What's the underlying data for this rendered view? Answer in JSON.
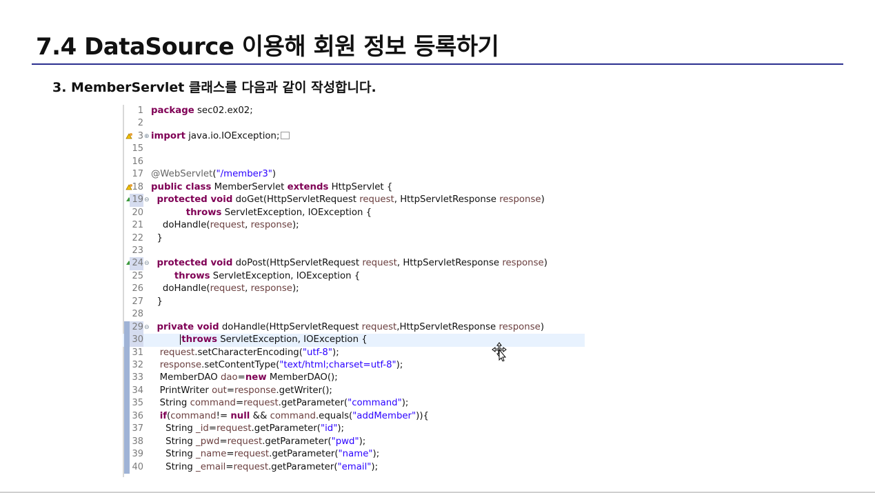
{
  "slide": {
    "title": "7.4 DataSource 이용해 회원 정보 등록하기",
    "subtitle": "3. MemberServlet 클래스를 다음과 같이 작성합니다."
  },
  "code_lines": [
    {
      "num": "1",
      "marker": "",
      "fold": "",
      "hl": false,
      "current": false,
      "tokens": [
        {
          "t": "package",
          "c": "kw"
        },
        {
          "t": " sec02.ex02;",
          "c": ""
        }
      ]
    },
    {
      "num": "2",
      "marker": "",
      "fold": "",
      "hl": false,
      "current": false,
      "tokens": []
    },
    {
      "num": "3",
      "marker": "warning",
      "fold": "plus",
      "hl": false,
      "current": false,
      "tokens": [
        {
          "t": "import",
          "c": "kw"
        },
        {
          "t": " java.io.IOException;",
          "c": ""
        },
        {
          "t": "",
          "c": "box"
        }
      ]
    },
    {
      "num": "15",
      "marker": "",
      "fold": "",
      "hl": false,
      "current": false,
      "tokens": []
    },
    {
      "num": "16",
      "marker": "",
      "fold": "",
      "hl": false,
      "current": false,
      "tokens": []
    },
    {
      "num": "17",
      "marker": "",
      "fold": "",
      "hl": false,
      "current": false,
      "tokens": [
        {
          "t": "@WebServlet",
          "c": "ann"
        },
        {
          "t": "(",
          "c": ""
        },
        {
          "t": "\"/member3\"",
          "c": "str"
        },
        {
          "t": ")",
          "c": ""
        }
      ]
    },
    {
      "num": "18",
      "marker": "warning",
      "fold": "",
      "hl": false,
      "current": false,
      "tokens": [
        {
          "t": "public class",
          "c": "kw"
        },
        {
          "t": " MemberServlet ",
          "c": ""
        },
        {
          "t": "extends",
          "c": "kw"
        },
        {
          "t": " HttpServlet {",
          "c": ""
        }
      ]
    },
    {
      "num": "19",
      "marker": "override",
      "fold": "minus",
      "hl": true,
      "current": false,
      "tokens": [
        {
          "t": "  ",
          "c": ""
        },
        {
          "t": "protected void",
          "c": "kw"
        },
        {
          "t": " doGet(HttpServletRequest ",
          "c": ""
        },
        {
          "t": "request",
          "c": "fld"
        },
        {
          "t": ", HttpServletResponse ",
          "c": ""
        },
        {
          "t": "response",
          "c": "fld"
        },
        {
          "t": ")",
          "c": ""
        }
      ]
    },
    {
      "num": "20",
      "marker": "",
      "fold": "",
      "hl": false,
      "current": false,
      "tokens": [
        {
          "t": "            ",
          "c": ""
        },
        {
          "t": "throws",
          "c": "kw"
        },
        {
          "t": " ServletException, IOException {",
          "c": ""
        }
      ]
    },
    {
      "num": "21",
      "marker": "",
      "fold": "",
      "hl": false,
      "current": false,
      "tokens": [
        {
          "t": "    doHandle(",
          "c": ""
        },
        {
          "t": "request",
          "c": "fld"
        },
        {
          "t": ", ",
          "c": ""
        },
        {
          "t": "response",
          "c": "fld"
        },
        {
          "t": ");",
          "c": ""
        }
      ]
    },
    {
      "num": "22",
      "marker": "",
      "fold": "",
      "hl": false,
      "current": false,
      "tokens": [
        {
          "t": "  }",
          "c": ""
        }
      ]
    },
    {
      "num": "23",
      "marker": "",
      "fold": "",
      "hl": false,
      "current": false,
      "tokens": []
    },
    {
      "num": "24",
      "marker": "override",
      "fold": "minus",
      "hl": true,
      "current": false,
      "tokens": [
        {
          "t": "  ",
          "c": ""
        },
        {
          "t": "protected void",
          "c": "kw"
        },
        {
          "t": " doPost(HttpServletRequest ",
          "c": ""
        },
        {
          "t": "request",
          "c": "fld"
        },
        {
          "t": ", HttpServletResponse ",
          "c": ""
        },
        {
          "t": "response",
          "c": "fld"
        },
        {
          "t": ")",
          "c": ""
        }
      ]
    },
    {
      "num": "25",
      "marker": "",
      "fold": "",
      "hl": false,
      "current": false,
      "tokens": [
        {
          "t": "        ",
          "c": ""
        },
        {
          "t": "throws",
          "c": "kw"
        },
        {
          "t": " ServletException, IOException {",
          "c": ""
        }
      ]
    },
    {
      "num": "26",
      "marker": "",
      "fold": "",
      "hl": false,
      "current": false,
      "tokens": [
        {
          "t": "    doHandle(",
          "c": ""
        },
        {
          "t": "request",
          "c": "fld"
        },
        {
          "t": ", ",
          "c": ""
        },
        {
          "t": "response",
          "c": "fld"
        },
        {
          "t": ");",
          "c": ""
        }
      ]
    },
    {
      "num": "27",
      "marker": "",
      "fold": "",
      "hl": false,
      "current": false,
      "tokens": [
        {
          "t": "  }",
          "c": ""
        }
      ]
    },
    {
      "num": "28",
      "marker": "",
      "fold": "",
      "hl": false,
      "current": false,
      "tokens": []
    },
    {
      "num": "29",
      "marker": "bluebar",
      "fold": "minus",
      "hl": true,
      "current": false,
      "tokens": [
        {
          "t": "  ",
          "c": ""
        },
        {
          "t": "private void",
          "c": "kw"
        },
        {
          "t": " doHandle(HttpServletRequest ",
          "c": ""
        },
        {
          "t": "request",
          "c": "fld"
        },
        {
          "t": ",HttpServletResponse ",
          "c": ""
        },
        {
          "t": "response",
          "c": "fld"
        },
        {
          "t": ")",
          "c": ""
        }
      ]
    },
    {
      "num": "30",
      "marker": "bluebar",
      "fold": "",
      "hl": true,
      "current": true,
      "tokens": [
        {
          "t": "          ",
          "c": ""
        },
        {
          "t": "",
          "c": "caret"
        },
        {
          "t": "throws",
          "c": "kw"
        },
        {
          "t": " ServletException, IOException {",
          "c": ""
        }
      ]
    },
    {
      "num": "31",
      "marker": "bluebar",
      "fold": "",
      "hl": false,
      "current": false,
      "tokens": [
        {
          "t": "   ",
          "c": ""
        },
        {
          "t": "request",
          "c": "fld"
        },
        {
          "t": ".setCharacterEncoding(",
          "c": ""
        },
        {
          "t": "\"utf-8\"",
          "c": "str"
        },
        {
          "t": ");",
          "c": ""
        }
      ]
    },
    {
      "num": "32",
      "marker": "bluebar",
      "fold": "",
      "hl": false,
      "current": false,
      "tokens": [
        {
          "t": "   ",
          "c": ""
        },
        {
          "t": "response",
          "c": "fld"
        },
        {
          "t": ".setContentType(",
          "c": ""
        },
        {
          "t": "\"text/html;charset=utf-8\"",
          "c": "str"
        },
        {
          "t": ");",
          "c": ""
        }
      ]
    },
    {
      "num": "33",
      "marker": "bluebar",
      "fold": "",
      "hl": false,
      "current": false,
      "tokens": [
        {
          "t": "   MemberDAO ",
          "c": ""
        },
        {
          "t": "dao",
          "c": "fld"
        },
        {
          "t": "=",
          "c": ""
        },
        {
          "t": "new",
          "c": "kw"
        },
        {
          "t": " MemberDAO();",
          "c": ""
        }
      ]
    },
    {
      "num": "34",
      "marker": "bluebar",
      "fold": "",
      "hl": false,
      "current": false,
      "tokens": [
        {
          "t": "   PrintWriter ",
          "c": ""
        },
        {
          "t": "out",
          "c": "fld"
        },
        {
          "t": "=",
          "c": ""
        },
        {
          "t": "response",
          "c": "fld"
        },
        {
          "t": ".getWriter();",
          "c": ""
        }
      ]
    },
    {
      "num": "35",
      "marker": "bluebar",
      "fold": "",
      "hl": false,
      "current": false,
      "tokens": [
        {
          "t": "   String ",
          "c": ""
        },
        {
          "t": "command",
          "c": "fld"
        },
        {
          "t": "=",
          "c": ""
        },
        {
          "t": "request",
          "c": "fld"
        },
        {
          "t": ".getParameter(",
          "c": ""
        },
        {
          "t": "\"command\"",
          "c": "str"
        },
        {
          "t": ");",
          "c": ""
        }
      ]
    },
    {
      "num": "36",
      "marker": "bluebar",
      "fold": "",
      "hl": false,
      "current": false,
      "tokens": [
        {
          "t": "   ",
          "c": ""
        },
        {
          "t": "if",
          "c": "kw"
        },
        {
          "t": "(",
          "c": ""
        },
        {
          "t": "command",
          "c": "fld"
        },
        {
          "t": "!= ",
          "c": ""
        },
        {
          "t": "null",
          "c": "kw"
        },
        {
          "t": " && ",
          "c": ""
        },
        {
          "t": "command",
          "c": "fld"
        },
        {
          "t": ".equals(",
          "c": ""
        },
        {
          "t": "\"addMember\"",
          "c": "str"
        },
        {
          "t": ")){",
          "c": ""
        }
      ]
    },
    {
      "num": "37",
      "marker": "bluebar",
      "fold": "",
      "hl": false,
      "current": false,
      "tokens": [
        {
          "t": "     String ",
          "c": ""
        },
        {
          "t": "_id",
          "c": "fld"
        },
        {
          "t": "=",
          "c": ""
        },
        {
          "t": "request",
          "c": "fld"
        },
        {
          "t": ".getParameter(",
          "c": ""
        },
        {
          "t": "\"id\"",
          "c": "str"
        },
        {
          "t": ");",
          "c": ""
        }
      ]
    },
    {
      "num": "38",
      "marker": "bluebar",
      "fold": "",
      "hl": false,
      "current": false,
      "tokens": [
        {
          "t": "     String ",
          "c": ""
        },
        {
          "t": "_pwd",
          "c": "fld"
        },
        {
          "t": "=",
          "c": ""
        },
        {
          "t": "request",
          "c": "fld"
        },
        {
          "t": ".getParameter(",
          "c": ""
        },
        {
          "t": "\"pwd\"",
          "c": "str"
        },
        {
          "t": ");",
          "c": ""
        }
      ]
    },
    {
      "num": "39",
      "marker": "bluebar",
      "fold": "",
      "hl": false,
      "current": false,
      "tokens": [
        {
          "t": "     String ",
          "c": ""
        },
        {
          "t": "_name",
          "c": "fld"
        },
        {
          "t": "=",
          "c": ""
        },
        {
          "t": "request",
          "c": "fld"
        },
        {
          "t": ".getParameter(",
          "c": ""
        },
        {
          "t": "\"name\"",
          "c": "str"
        },
        {
          "t": ");",
          "c": ""
        }
      ]
    },
    {
      "num": "40",
      "marker": "bluebar",
      "fold": "",
      "hl": false,
      "current": false,
      "tokens": [
        {
          "t": "     String ",
          "c": ""
        },
        {
          "t": "_email",
          "c": "fld"
        },
        {
          "t": "=",
          "c": ""
        },
        {
          "t": "request",
          "c": "fld"
        },
        {
          "t": ".getParameter(",
          "c": ""
        },
        {
          "t": "\"email\"",
          "c": "str"
        },
        {
          "t": ");",
          "c": ""
        }
      ]
    }
  ],
  "icons": {
    "warning": "warning-icon",
    "override": "override-arrow-icon",
    "cursor": "move-cursor-icon"
  },
  "colors": {
    "title_rule": "#2b2f8f",
    "keyword": "#7f0055",
    "string": "#2a00ff",
    "variable": "#6a3e3e",
    "annotation": "#646464"
  }
}
